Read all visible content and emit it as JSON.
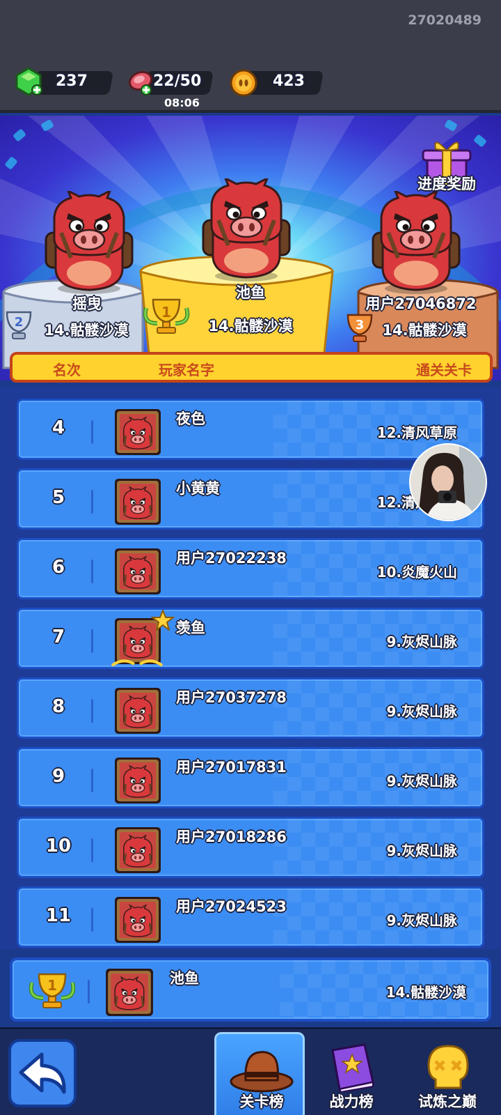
{
  "topbar": {
    "user_id": "27020489",
    "gems": "237",
    "energy": "22/50",
    "energy_timer": "08:06",
    "coins": "423"
  },
  "podium": {
    "rewards_label": "进度奖励",
    "first": {
      "rank": "1",
      "name": "池鱼",
      "stage": "14.骷髅沙漠"
    },
    "second": {
      "rank": "2",
      "name": "摇曳",
      "stage": "14.骷髅沙漠"
    },
    "third": {
      "rank": "3",
      "name": "用户27046872",
      "stage": "14.骷髅沙漠"
    }
  },
  "header": {
    "rank_col": "名次",
    "name_col": "玩家名字",
    "stage_col": "通关关卡"
  },
  "rows": [
    {
      "rank": "4",
      "name": "夜色",
      "stage": "12.清风草原"
    },
    {
      "rank": "5",
      "name": "小黄黄",
      "stage": "12.清风草原"
    },
    {
      "rank": "6",
      "name": "用户27022238",
      "stage": "10.炎魔火山"
    },
    {
      "rank": "7",
      "name": "羡鱼",
      "stage": "9.灰烬山脉"
    },
    {
      "rank": "8",
      "name": "用户27037278",
      "stage": "9.灰烬山脉"
    },
    {
      "rank": "9",
      "name": "用户27017831",
      "stage": "9.灰烬山脉"
    },
    {
      "rank": "10",
      "name": "用户27018286",
      "stage": "9.灰烬山脉"
    },
    {
      "rank": "11",
      "name": "用户27024523",
      "stage": "9.灰烬山脉"
    }
  ],
  "self": {
    "rank": "1",
    "name": "池鱼",
    "stage": "14.骷髅沙漠"
  },
  "nav": {
    "tabs": [
      {
        "label": "关卡榜",
        "icon": "cowboy-hat-icon",
        "active": true
      },
      {
        "label": "战力榜",
        "icon": "spellbook-icon",
        "active": false
      },
      {
        "label": "试炼之巅",
        "icon": "golden-skull-icon",
        "active": false
      }
    ]
  }
}
